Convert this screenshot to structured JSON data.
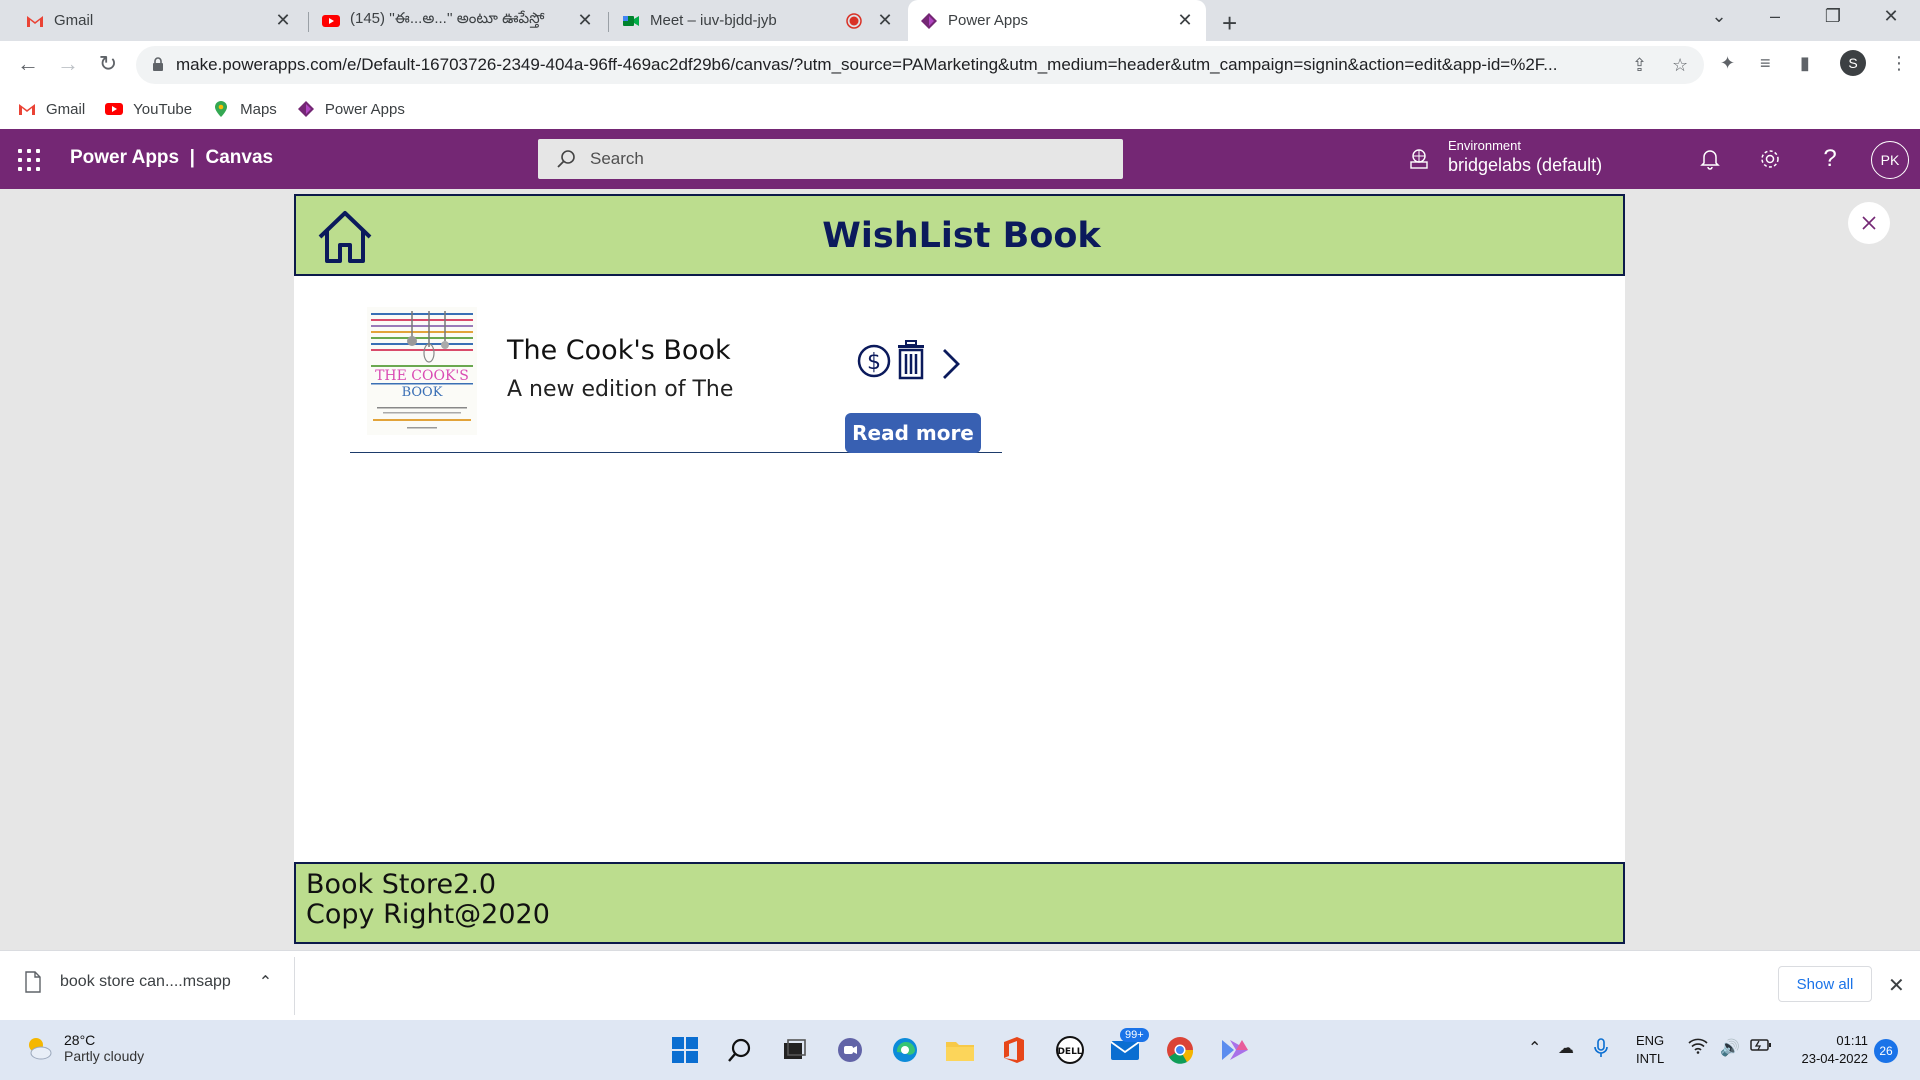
{
  "browser": {
    "tabs": [
      {
        "title": "Gmail",
        "close": "✕"
      },
      {
        "title": "(145) ''ఈ...అ...'' అంటూ ఊపేస్తో",
        "close": "✕"
      },
      {
        "title": "Meet – iuv-bjdd-jyb",
        "close": "✕"
      },
      {
        "title": "Power Apps",
        "close": "✕"
      }
    ],
    "new_tab": "+",
    "url": "make.powerapps.com/e/Default-16703726-2349-404a-96ff-469ac2df29b6/canvas/?utm_source=PAMarketing&utm_medium=header&utm_campaign=signin&action=edit&app-id=%2F...",
    "profile_initial": "S",
    "bookmarks": [
      {
        "label": "Gmail"
      },
      {
        "label": "YouTube"
      },
      {
        "label": "Maps"
      },
      {
        "label": "Power Apps"
      }
    ]
  },
  "powerapps": {
    "brand": "Power Apps  |  Canvas",
    "search_placeholder": "Search",
    "environment_label": "Environment",
    "environment_value": "bridgelabs (default)",
    "avatar": "PK"
  },
  "app": {
    "title": "WishList Book",
    "items": [
      {
        "title": "The Cook's Book",
        "description": "A new edition of The",
        "cover_text": "THE COOK'S BOOK",
        "button_label": "Read more"
      }
    ],
    "footer_line1": "Book Store2.0",
    "footer_line2": "Copy Right@2020"
  },
  "downloads": {
    "file_name": "book store can....msapp",
    "show_all": "Show all"
  },
  "taskbar": {
    "temperature": "28°C",
    "condition": "Partly cloudy",
    "mail_badge": "99+",
    "lang_line1": "ENG",
    "lang_line2": "INTL",
    "time": "01:11",
    "date": "23-04-2022",
    "notification_count": "26"
  },
  "colors": {
    "powerapps_purple": "#742774",
    "app_header_green": "#bcdd8e",
    "title_navy": "#0b1a5c",
    "button_blue": "#3860b2"
  }
}
